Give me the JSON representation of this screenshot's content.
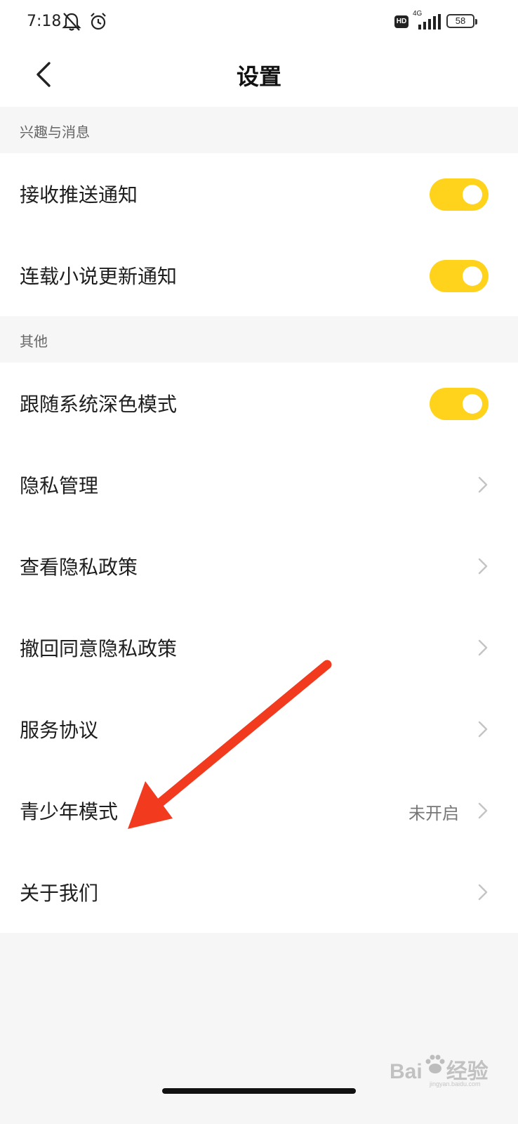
{
  "status_bar": {
    "time": "7:18",
    "icons": [
      "bell-off-icon",
      "alarm-icon"
    ],
    "hd": "HD",
    "network": "4G",
    "signal_icon": "signal-bars-icon",
    "battery": "58"
  },
  "header": {
    "back_icon": "chevron-left-icon",
    "title": "设置"
  },
  "sections": [
    {
      "title": "兴趣与消息",
      "items": [
        {
          "label": "接收推送通知",
          "toggle": true
        },
        {
          "label": "连载小说更新通知",
          "toggle": true
        }
      ]
    },
    {
      "title": "其他",
      "items": [
        {
          "label": "跟随系统深色模式",
          "toggle": true
        },
        {
          "label": "隐私管理"
        },
        {
          "label": "查看隐私政策"
        },
        {
          "label": "撤回同意隐私政策"
        },
        {
          "label": "服务协议"
        },
        {
          "label": "青少年模式",
          "value": "未开启"
        },
        {
          "label": "关于我们"
        }
      ]
    }
  ],
  "colors": {
    "accent": "#ffd21c",
    "annotation_arrow": "#f23a1e",
    "background": "#f6f6f6"
  },
  "watermark": {
    "brand": "Bai",
    "brand_tail": "经验",
    "url": "jingyan.baidu.com"
  }
}
